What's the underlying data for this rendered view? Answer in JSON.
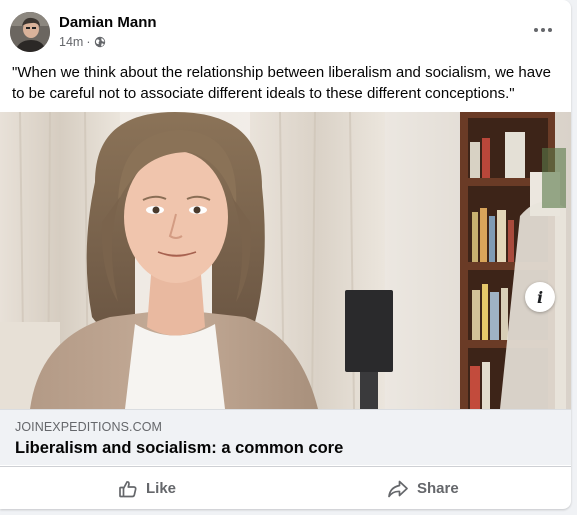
{
  "post": {
    "author": "Damian Mann",
    "time": "14m",
    "separator": "·",
    "visibility_icon": "globe-icon",
    "text": "\"When we think about the relationship between liberalism and socialism, we have to be careful not to associate different ideals to these different conceptions.\""
  },
  "link": {
    "domain": "JOINEXPEDITIONS.COM",
    "title": "Liberalism and socialism: a common core",
    "info_label": "i"
  },
  "actions": {
    "like_label": "Like",
    "share_label": "Share"
  },
  "colors": {
    "text_primary": "#050505",
    "text_secondary": "#65676b",
    "link_background": "#f0f2f5"
  }
}
